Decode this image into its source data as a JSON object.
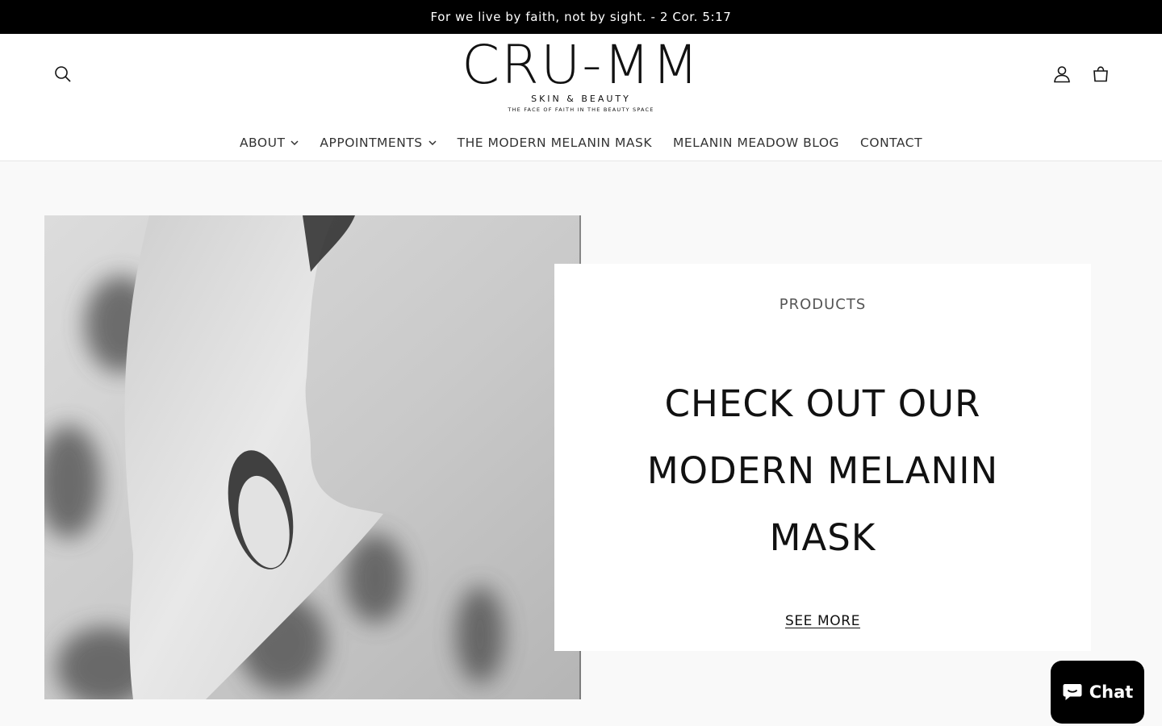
{
  "announcement": {
    "text": "For we live by faith, not by sight. - 2 Cor. 5:17"
  },
  "header": {
    "logo": {
      "main": "CRU-MM",
      "sub": "SKIN & BEAUTY",
      "tagline": "THE FACE OF FAITH IN THE BEAUTY SPACE"
    },
    "icons": {
      "search": "search-icon",
      "account": "account-icon",
      "cart": "cart-icon"
    }
  },
  "nav": {
    "items": [
      {
        "label": "ABOUT",
        "has_dropdown": true
      },
      {
        "label": "APPOINTMENTS",
        "has_dropdown": true
      },
      {
        "label": "THE MODERN MELANIN MASK",
        "has_dropdown": false
      },
      {
        "label": "MELANIN MEADOW BLOG",
        "has_dropdown": false
      },
      {
        "label": "CONTACT",
        "has_dropdown": false
      }
    ]
  },
  "hero": {
    "eyebrow": "PRODUCTS",
    "headline": "CHECK OUT OUR MODERN MELANIN MASK",
    "cta": "SEE MORE"
  },
  "chat": {
    "label": "Chat"
  },
  "colors": {
    "announcement_bg": "#000000",
    "page_bg": "#f9f9f9",
    "box_bg": "#ffffff",
    "chat_bg": "#000000"
  }
}
